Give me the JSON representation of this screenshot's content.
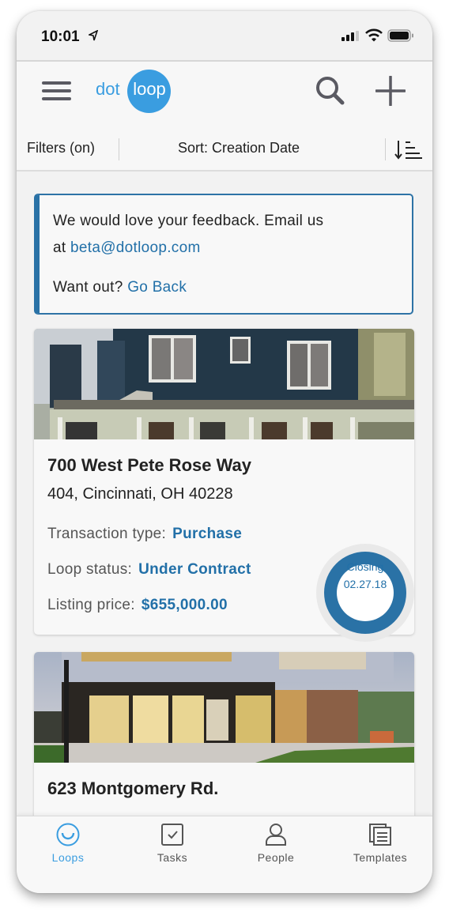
{
  "status_bar": {
    "time": "10:01"
  },
  "app_bar": {
    "logo_left": "dot",
    "logo_right": "loop"
  },
  "filter_bar": {
    "filters_label": "Filters (on)",
    "sort_label": "Sort: Creation Date"
  },
  "banner": {
    "line1": "We would love your feedback. Email us",
    "line2_prefix": "at ",
    "email_link": "beta@dotloop.com",
    "line3_prefix": "Want out? ",
    "go_back_link": "Go Back"
  },
  "loops": [
    {
      "address_line1": "700 West Pete Rose Way",
      "address_line2": "404, Cincinnati, OH 40228",
      "transaction_type_label": "Transaction type:",
      "transaction_type": "Purchase",
      "loop_status_label": "Loop status:",
      "loop_status": "Under Contract",
      "listing_price_label": "Listing price:",
      "listing_price": "$655,000.00",
      "closing_label": "Closing",
      "closing_date": "02.27.18"
    },
    {
      "address_line1": "623 Montgomery Rd."
    }
  ],
  "tab_bar": {
    "tabs": [
      {
        "label": "Loops",
        "icon": "smile-circle-icon",
        "active": true
      },
      {
        "label": "Tasks",
        "icon": "checkbox-icon",
        "active": false
      },
      {
        "label": "People",
        "icon": "person-icon",
        "active": false
      },
      {
        "label": "Templates",
        "icon": "templates-icon",
        "active": false
      }
    ]
  },
  "colors": {
    "accent": "#3a9de0",
    "link": "#2270a8",
    "banner_border": "#2a72a6"
  }
}
